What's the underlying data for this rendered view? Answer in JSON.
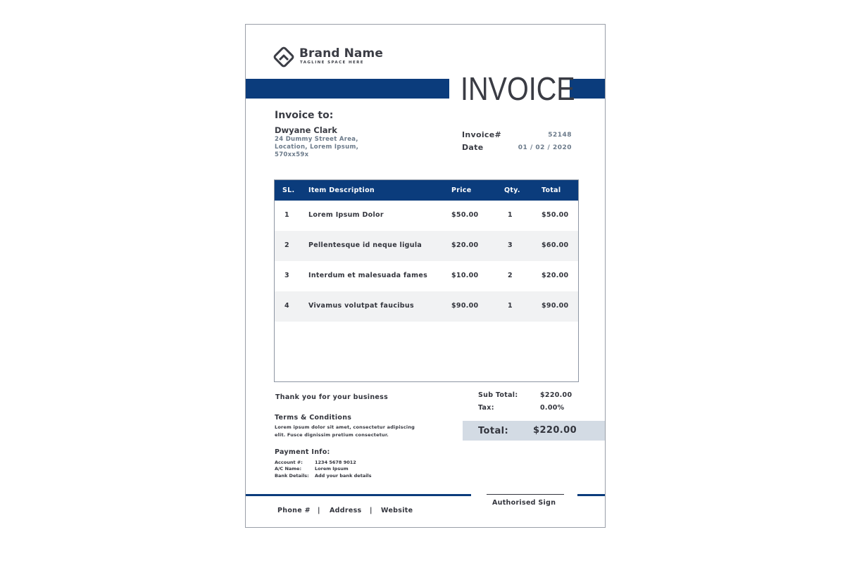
{
  "brand": {
    "name": "Brand Name",
    "tagline": "TAGLINE SPACE HERE"
  },
  "title": "INVOICE",
  "bill_to": {
    "label": "Invoice to:",
    "name": "Dwyane Clark",
    "address": [
      "24 Dummy Street Area,",
      "Location, Lorem Ipsum,",
      "570xx59x"
    ]
  },
  "meta": {
    "invoice_label": "Invoice#",
    "invoice_value": "52148",
    "date_label": "Date",
    "date_value": "01 / 02 / 2020"
  },
  "table": {
    "headers": [
      "SL.",
      "Item Description",
      "Price",
      "Qty.",
      "Total"
    ],
    "rows": [
      [
        "1",
        "Lorem Ipsum Dolor",
        "$50.00",
        "1",
        "$50.00"
      ],
      [
        "2",
        "Pellentesque id neque ligula",
        "$20.00",
        "3",
        "$60.00"
      ],
      [
        "3",
        "Interdum et malesuada fames",
        "$10.00",
        "2",
        "$20.00"
      ],
      [
        "4",
        "Vivamus volutpat faucibus",
        "$90.00",
        "1",
        "$90.00"
      ]
    ]
  },
  "thanks": "Thank you for your business",
  "terms": {
    "heading": "Terms & Conditions",
    "lines": [
      "Lorem ipsum dolor sit amet, consectetur adipiscing",
      "elit. Fusce dignissim pretium consectetur."
    ]
  },
  "payment": {
    "heading": "Payment Info:",
    "rows": [
      [
        "Account #:",
        "1234 5678 9012"
      ],
      [
        "A/C Name:",
        "Lorem Ipsum"
      ],
      [
        "Bank Details:",
        "Add your bank details"
      ]
    ]
  },
  "summary": {
    "subtotal_label": "Sub Total:",
    "subtotal_value": "$220.00",
    "tax_label": "Tax:",
    "tax_value": "0.00%",
    "total_label": "Total:",
    "total_value": "$220.00"
  },
  "signature": "Authorised Sign",
  "footer": {
    "phone": "Phone #",
    "address": "Address",
    "website": "Website",
    "separator": "|"
  },
  "colors": {
    "accent": "#0b3c7c",
    "total_bg": "#d3dbe4",
    "row_alt": "#f1f2f3"
  }
}
